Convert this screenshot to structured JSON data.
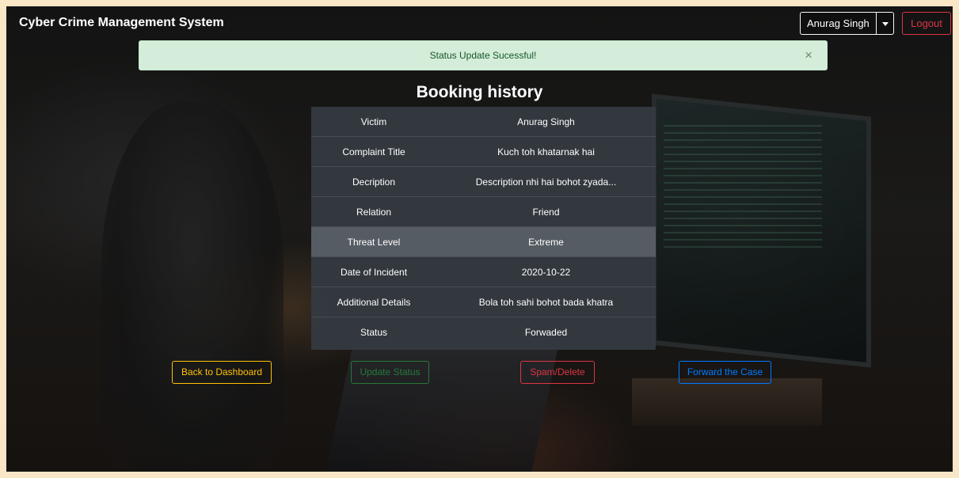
{
  "navbar": {
    "brand": "Cyber Crime Management System",
    "user_name": "Anurag Singh",
    "logout_label": "Logout"
  },
  "alert": {
    "message": "Status Update Sucessful!",
    "close_glyph": "×"
  },
  "page": {
    "title": "Booking history"
  },
  "details": {
    "rows": [
      {
        "label": "Victim",
        "value": "Anurag Singh"
      },
      {
        "label": "Complaint Title",
        "value": "Kuch toh khatarnak hai"
      },
      {
        "label": "Decription",
        "value": "Description nhi hai bohot zyada..."
      },
      {
        "label": "Relation",
        "value": "Friend"
      },
      {
        "label": "Threat Level",
        "value": "Extreme"
      },
      {
        "label": "Date of Incident",
        "value": "2020-10-22"
      },
      {
        "label": "Additional Details",
        "value": "Bola toh sahi bohot bada khatra"
      },
      {
        "label": "Status",
        "value": "Forwaded"
      }
    ]
  },
  "actions": {
    "back_label": "Back to Dashboard",
    "update_label": "Update Status",
    "spam_label": "Spam/Delete",
    "forward_label": "Forward the Case"
  },
  "colors": {
    "warning": "#ffc107",
    "success": "#28a745",
    "danger": "#dc3545",
    "primary": "#007bff",
    "alert_bg": "#d4edda",
    "table_bg": "#343a40"
  }
}
